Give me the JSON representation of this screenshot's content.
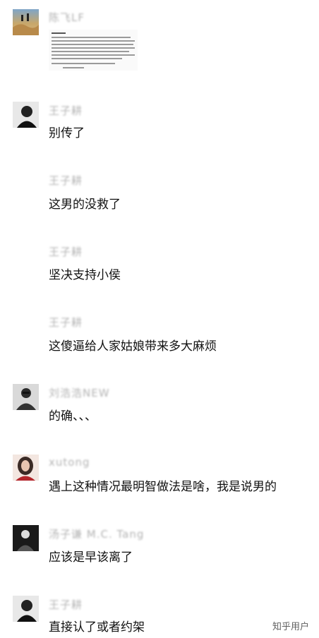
{
  "messages": [
    {
      "name": "陈飞LF",
      "text": "",
      "has_image": true
    },
    {
      "name": "王子耕",
      "text": "别传了"
    },
    {
      "name": "王子耕",
      "text": "这男的没救了"
    },
    {
      "name": "王子耕",
      "text": "坚决支持小侯"
    },
    {
      "name": "王子耕",
      "text": "这傻逼给人家姑娘带来多大麻烦"
    },
    {
      "name": "刘浩浩NEW",
      "text": "的确、、、"
    },
    {
      "name": "xutong",
      "text": "遇上这种情况最明智做法是啥，我是说男的"
    },
    {
      "name": "汤子谦 M.C. Tang",
      "text": "应该是早该离了"
    },
    {
      "name": "王子耕",
      "text": "直接认了或者约架"
    }
  ],
  "watermark": "知乎用户"
}
